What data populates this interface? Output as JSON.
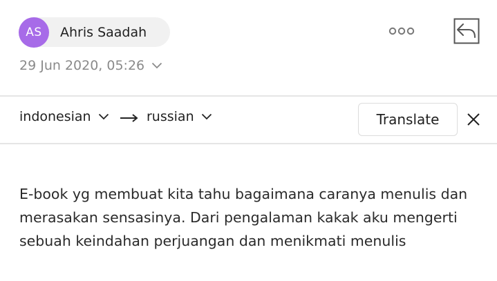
{
  "sender": {
    "initials": "AS",
    "name": "Ahris Saadah",
    "avatar_color": "#a76be8"
  },
  "date": {
    "text": "29 Jun 2020,  05:26"
  },
  "actions": {
    "more_icon": "more-horizontal-icon",
    "reply_icon": "reply-icon"
  },
  "translate_bar": {
    "source_lang": "indonesian",
    "target_lang": "russian",
    "translate_label": "Translate",
    "close_icon": "close-icon"
  },
  "message": {
    "body": "E-book yg membuat kita tahu bagaimana caranya menulis dan merasakan sensasinya. Dari pengalaman kakak aku mengerti sebuah keindahan perjuangan dan menikmati menulis"
  }
}
